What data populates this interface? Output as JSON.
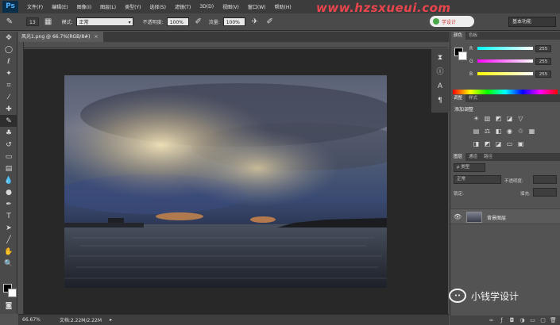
{
  "app": {
    "logo": "Ps",
    "watermark": "www.hzsxueui.com"
  },
  "menu": [
    "文件(F)",
    "编辑(E)",
    "图像(I)",
    "图层(L)",
    "类型(Y)",
    "选择(S)",
    "滤镜(T)",
    "3D(D)",
    "视图(V)",
    "窗口(W)",
    "帮助(H)"
  ],
  "options": {
    "brush_size": "13",
    "mode_label": "模式:",
    "mode_value": "正常",
    "opacity_label": "不透明度:",
    "opacity_value": "100%",
    "flow_label": "流量:",
    "flow_value": "100%",
    "workspace_pill": "学设计",
    "workspace_select": "基本功能"
  },
  "document": {
    "tab_title": "风光1.png @ 66.7%(RGB/8#)",
    "zoom": "66.67%",
    "doc_size": "文档:2.22M/2.22M"
  },
  "panels": {
    "color_tabs": [
      "颜色",
      "色板"
    ],
    "color_sliders": [
      {
        "label": "R",
        "value": "255"
      },
      {
        "label": "G",
        "value": "255"
      },
      {
        "label": "B",
        "value": "255"
      }
    ],
    "adj_tabs": [
      "调整",
      "样式"
    ],
    "adj_title": "添加调整",
    "layers_tabs": [
      "图层",
      "通道",
      "路径"
    ],
    "layer_kind": "ρ 类型",
    "blend_mode": "正常",
    "opacity_label": "不透明度:",
    "lock_label": "锁定:",
    "fill_label": "填充:",
    "layer_name": "背景图层"
  },
  "wechat": {
    "text": "小钱学设计"
  },
  "colors": {
    "accent_watermark": "#e8454d",
    "pill_dot": "#4aa84a"
  }
}
